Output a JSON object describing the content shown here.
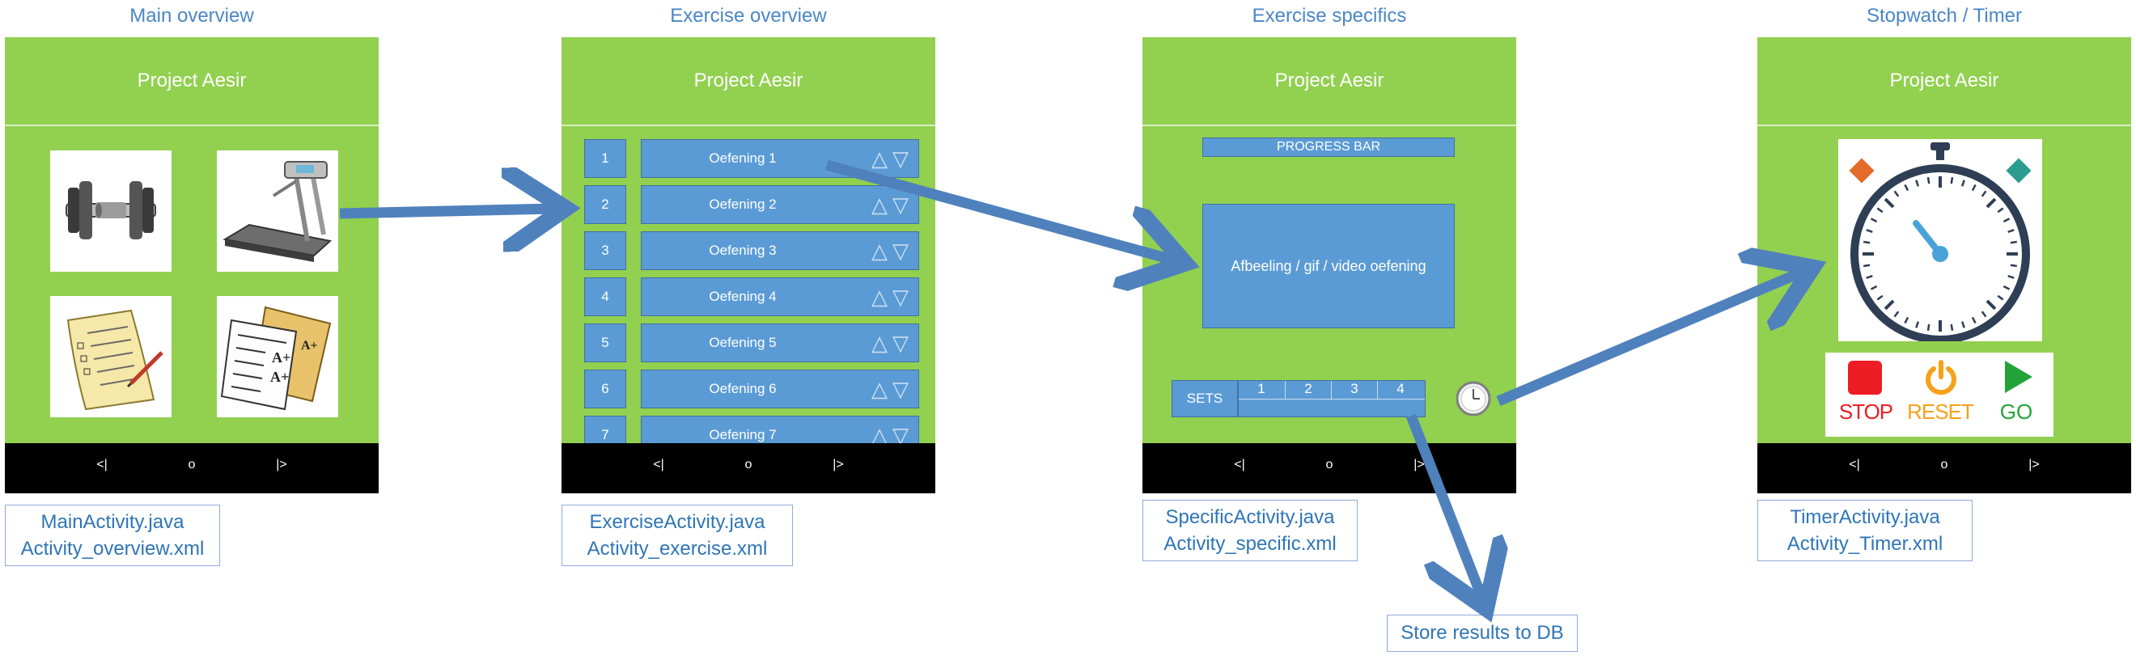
{
  "headings": {
    "main": "Main overview",
    "exercise": "Exercise overview",
    "specifics": "Exercise specifics",
    "timer": "Stopwatch / Timer"
  },
  "app_title": "Project Aesir",
  "nav": {
    "back": "<|",
    "home": "o",
    "forward": "|>"
  },
  "main_overview": {
    "tiles": [
      "dumbbell-icon",
      "treadmill-icon",
      "notepad-icon",
      "report-card-icon"
    ],
    "caption": [
      "MainActivity.java",
      "Activity_overview.xml"
    ]
  },
  "exercise_overview": {
    "items": [
      {
        "num": "1",
        "label": "Oefening 1"
      },
      {
        "num": "2",
        "label": "Oefening 2"
      },
      {
        "num": "3",
        "label": "Oefening 3"
      },
      {
        "num": "4",
        "label": "Oefening 4"
      },
      {
        "num": "5",
        "label": "Oefening 5"
      },
      {
        "num": "6",
        "label": "Oefening 6"
      },
      {
        "num": "7",
        "label": "Oefening 7"
      }
    ],
    "caption": [
      "ExerciseActivity.java",
      "Activity_exercise.xml"
    ]
  },
  "exercise_specifics": {
    "progress_label": "PROGRESS BAR",
    "media_label": "Afbeeling / gif / video oefening",
    "sets_label": "SETS",
    "sets": [
      "1",
      "2",
      "3",
      "4"
    ],
    "caption": [
      "SpecificActivity.java",
      "Activity_specific.xml"
    ]
  },
  "timer": {
    "buttons": {
      "stop": "STOP",
      "reset": "RESET",
      "go": "GO"
    },
    "caption": [
      "TimerActivity.java",
      "Activity_Timer.xml"
    ]
  },
  "store_results": "Store results to DB",
  "colors": {
    "phone_green": "#92d050",
    "button_blue": "#5b9bd5",
    "arrow_blue": "#4f81bd",
    "heading_blue": "#4a86c6"
  }
}
